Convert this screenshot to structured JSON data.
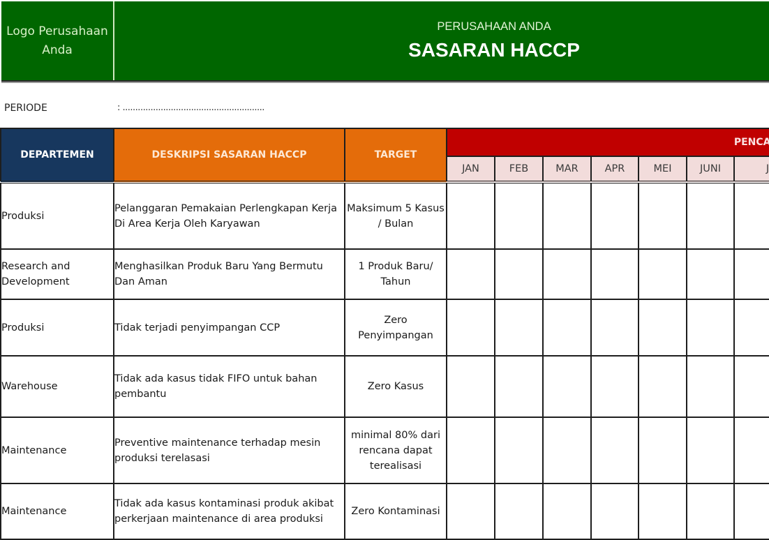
{
  "header": {
    "logo_text": "Logo Perusahaan Anda",
    "company": "PERUSAHAAN ANDA",
    "title": "SASARAN HACCP",
    "colors": {
      "banner": "#006600",
      "dept_header": "#17375e",
      "desc_header": "#e46c0a",
      "achievement_header": "#c00000",
      "month_header": "#f2dcdb"
    }
  },
  "periode": {
    "label": "PERIODE",
    "value": ": ........................................................"
  },
  "table": {
    "columns": {
      "department": "DEPARTEMEN",
      "description": "DESKRIPSI SASARAN HACCP",
      "target": "TARGET",
      "achievement": "PENCAPAIAN"
    },
    "months": [
      "JAN",
      "FEB",
      "MAR",
      "APR",
      "MEI",
      "JUNI",
      "JULI"
    ],
    "rows": [
      {
        "department": "Produksi",
        "description": "Pelanggaran  Pemakaian Perlengkapan Kerja Di Area Kerja Oleh Karyawan",
        "target": "Maksimum 5 Kasus / Bulan"
      },
      {
        "department": "Research and Development",
        "description": "Menghasilkan Produk Baru Yang Bermutu Dan Aman",
        "target": "1 Produk Baru/ Tahun"
      },
      {
        "department": "Produksi",
        "description": "Tidak terjadi penyimpangan CCP",
        "target": "Zero Penyimpangan"
      },
      {
        "department": "Warehouse",
        "description": "Tidak ada kasus tidak FIFO untuk bahan pembantu",
        "target": "Zero Kasus"
      },
      {
        "department": "Maintenance",
        "description": "Preventive maintenance terhadap mesin produksi terelasasi",
        "target": "minimal 80% dari rencana dapat terealisasi"
      },
      {
        "department": "Maintenance",
        "description": "Tidak ada kasus kontaminasi produk akibat perkerjaan maintenance di area produksi",
        "target": "Zero Kontaminasi"
      }
    ]
  }
}
